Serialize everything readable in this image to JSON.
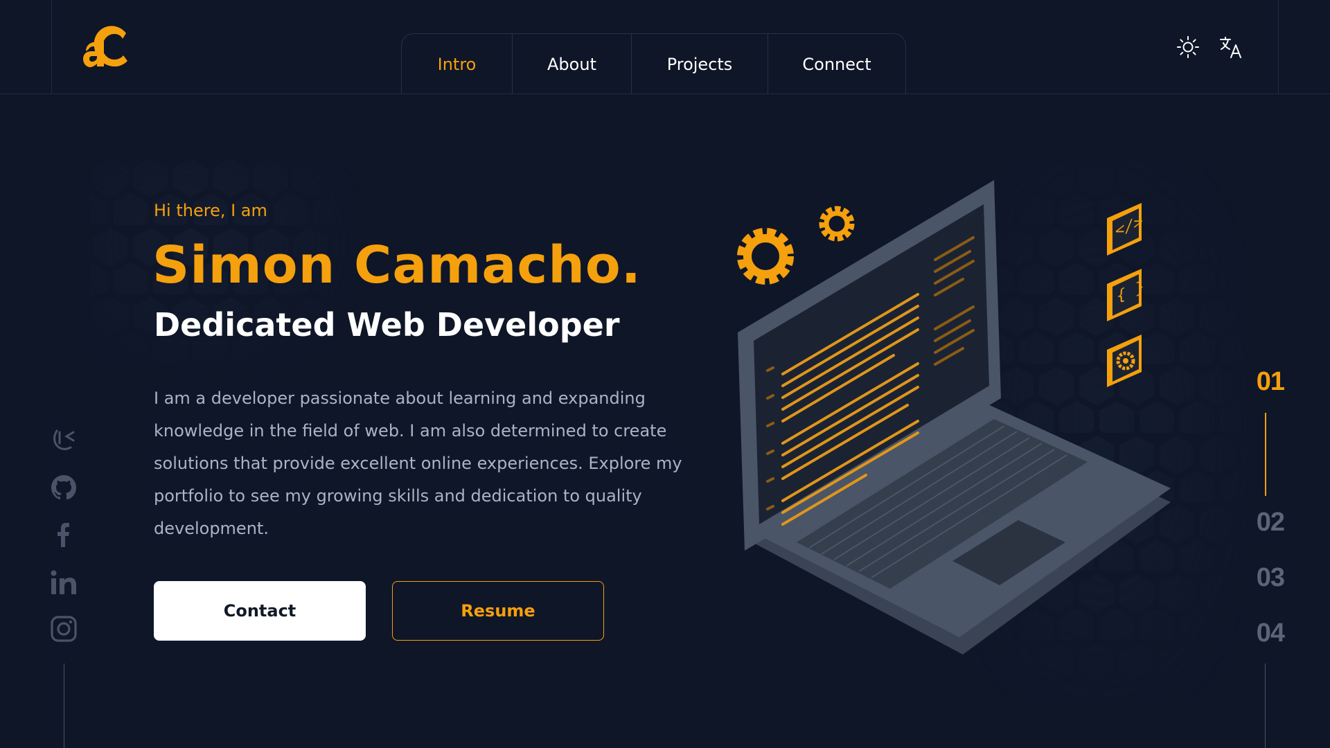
{
  "brand": {
    "logo_text": "aC",
    "accent": "#f5a00d",
    "background": "#0f1628"
  },
  "nav": {
    "items": [
      {
        "label": "Intro",
        "active": true
      },
      {
        "label": "About",
        "active": false
      },
      {
        "label": "Projects",
        "active": false
      },
      {
        "label": "Connect",
        "active": false
      }
    ]
  },
  "header_icons": [
    "sun-icon",
    "translate-icon"
  ],
  "hero": {
    "greeting": "Hi there, I am",
    "name": "Simon Camacho.",
    "role": "Dedicated Web Developer",
    "bio": "I am a developer passionate about learning and expanding knowledge in the field of web. I am also determined to create solutions that provide excellent online experiences. Explore my portfolio to see my growing skills and dedication to quality development.",
    "buttons": {
      "contact": "Contact",
      "resume": "Resume"
    }
  },
  "social": [
    "coderbyte-icon",
    "github-icon",
    "facebook-icon",
    "linkedin-icon",
    "instagram-icon"
  ],
  "pager": {
    "items": [
      "01",
      "02",
      "03",
      "04"
    ],
    "active": "01"
  }
}
